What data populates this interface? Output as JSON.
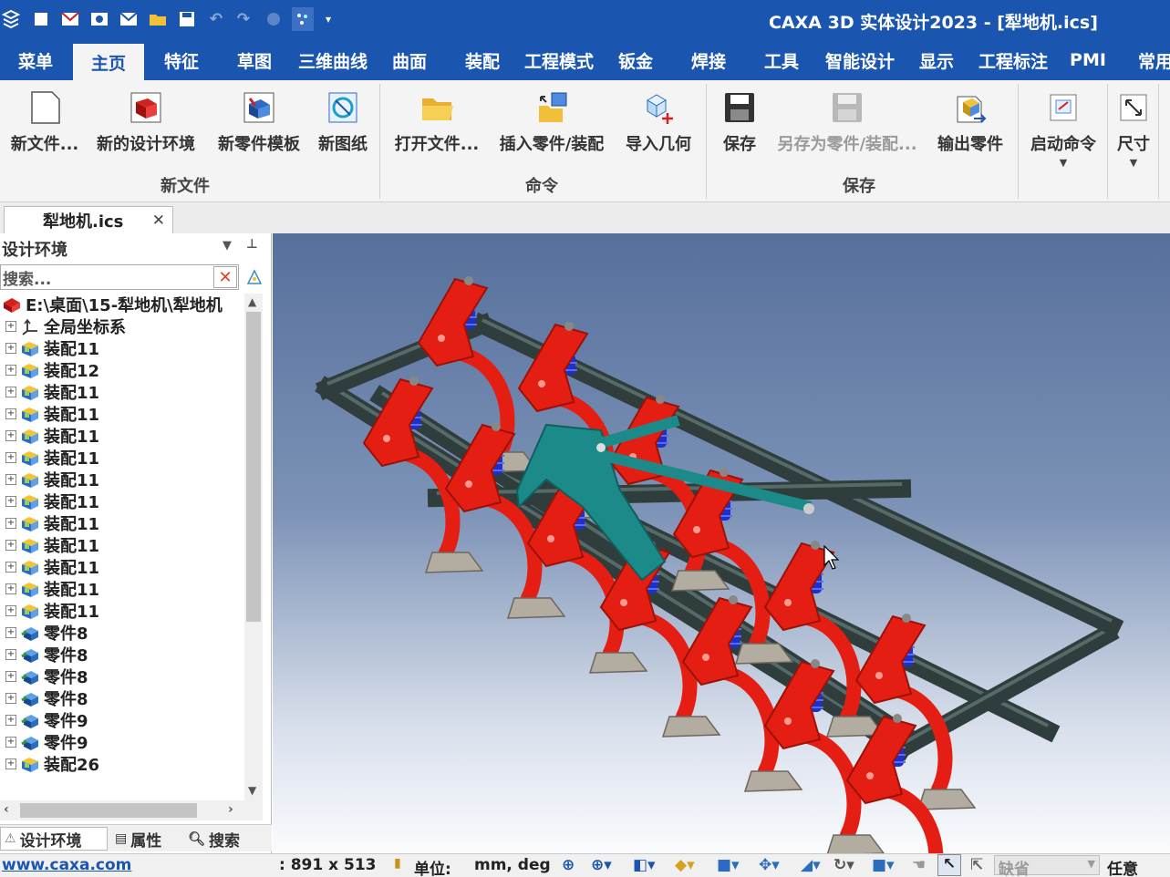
{
  "app": {
    "title": "CAXA 3D 实体设计2023 - [犁地机.ics]"
  },
  "quick_access": [
    "logo-icon",
    "new-icon",
    "mail-icon",
    "preview-icon",
    "send-icon",
    "open-icon",
    "save-icon",
    "undo-icon",
    "redo-icon",
    "globe-icon",
    "sparkle-icon",
    "customize-icon"
  ],
  "tabs": [
    {
      "label": "菜单"
    },
    {
      "label": "主页",
      "active": true
    },
    {
      "label": "特征"
    },
    {
      "label": "草图"
    },
    {
      "label": "三维曲线"
    },
    {
      "label": "曲面"
    },
    {
      "label": "装配"
    },
    {
      "label": "工程模式"
    },
    {
      "label": "钣金"
    },
    {
      "label": "焊接"
    },
    {
      "label": "工具"
    },
    {
      "label": "智能设计"
    },
    {
      "label": "显示"
    },
    {
      "label": "工程标注"
    },
    {
      "label": "PMI"
    },
    {
      "label": "常用"
    }
  ],
  "ribbon": {
    "groups": {
      "new_file": "新文件",
      "commands": "命令",
      "save": "保存"
    },
    "buttons": {
      "new_file": "新文件...",
      "new_env": "新的设计环境",
      "new_part_template": "新零件模板",
      "new_drawing": "新图纸",
      "open_file": "打开文件...",
      "insert_part": "插入零件/装配",
      "import_geometry": "导入几何",
      "save": "保存",
      "save_as": "另存为零件/装配...",
      "export_part": "输出零件",
      "start_command": "启动命令",
      "dimension": "尺寸"
    }
  },
  "document_tab": {
    "label": "犁地机.ics"
  },
  "panel": {
    "title": "设计环境",
    "search_placeholder": "搜索...",
    "root": "E:\\桌面\\15-犁地机\\犁地机",
    "items": [
      {
        "label": "全局坐标系",
        "icon": "coordinate-system-icon"
      },
      {
        "label": "装配11",
        "icon": "assembly-icon"
      },
      {
        "label": "装配12",
        "icon": "assembly-icon"
      },
      {
        "label": "装配11",
        "icon": "assembly-icon"
      },
      {
        "label": "装配11",
        "icon": "assembly-icon"
      },
      {
        "label": "装配11",
        "icon": "assembly-icon"
      },
      {
        "label": "装配11",
        "icon": "assembly-icon"
      },
      {
        "label": "装配11",
        "icon": "assembly-icon"
      },
      {
        "label": "装配11",
        "icon": "assembly-icon"
      },
      {
        "label": "装配11",
        "icon": "assembly-icon"
      },
      {
        "label": "装配11",
        "icon": "assembly-icon"
      },
      {
        "label": "装配11",
        "icon": "assembly-icon"
      },
      {
        "label": "装配11",
        "icon": "assembly-icon"
      },
      {
        "label": "装配11",
        "icon": "assembly-icon"
      },
      {
        "label": "零件8",
        "icon": "part-icon"
      },
      {
        "label": "零件8",
        "icon": "part-icon"
      },
      {
        "label": "零件8",
        "icon": "part-icon"
      },
      {
        "label": "零件8",
        "icon": "part-icon"
      },
      {
        "label": "零件9",
        "icon": "part-icon"
      },
      {
        "label": "零件9",
        "icon": "part-icon"
      },
      {
        "label": "装配26",
        "icon": "assembly-icon"
      }
    ],
    "bottom_tabs": [
      "设计环境",
      "属性",
      "搜索"
    ]
  },
  "status": {
    "website": "www.caxa.com",
    "size": ": 891 x 513",
    "unit_label": "单位:",
    "unit_value": "mm, deg",
    "default_value": "缺省",
    "any_label": "任意"
  },
  "colors": {
    "titlebar": "#1a56b0",
    "frame": "#2f3d3c",
    "shank_red": "#e41e12",
    "spring_blue": "#1e2fd0",
    "hitch_teal": "#1d8a8a",
    "sweep_grey": "#b3aca0"
  }
}
